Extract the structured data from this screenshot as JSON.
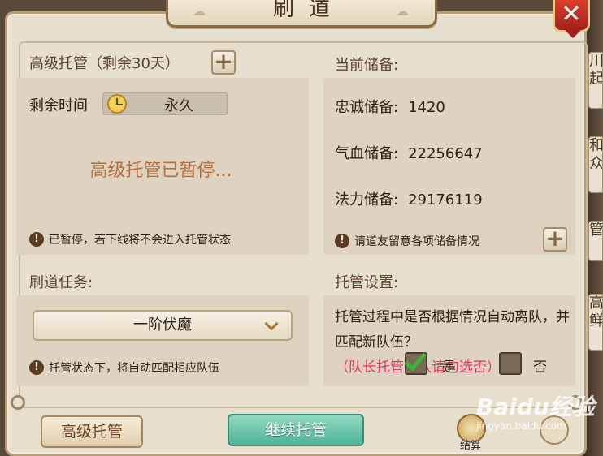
{
  "window": {
    "title": "刷道",
    "close_label": "✕"
  },
  "hosting": {
    "title": "高级托管（剩余30天）",
    "remaining_label": "剩余时间",
    "remaining_value": "永久",
    "status_text": "高级托管已暂停...",
    "note": "已暂停，若下线将不会进入托管状态"
  },
  "reserves": {
    "title": "当前储备:",
    "items": [
      {
        "label": "忠诚储备:",
        "value": "1420"
      },
      {
        "label": "气血储备:",
        "value": "22256647"
      },
      {
        "label": "法力储备:",
        "value": "29176119"
      }
    ],
    "note": "请道友留意各项储备情况"
  },
  "task": {
    "title": "刷道任务:",
    "selected": "一阶伏魔",
    "note": "托管状态下，将自动匹配相应队伍"
  },
  "settings": {
    "title": "托管设置:",
    "question": "托管过程中是否根据情况自动离队，并匹配新队伍？",
    "hint": "（队长托管带队请勾选否）",
    "yes_label": "是",
    "no_label": "否",
    "yes_checked": true,
    "no_checked": false
  },
  "buttons": {
    "advanced_hosting": "高级托管",
    "continue_hosting": "继续托管",
    "settle": "结算"
  },
  "side_tabs": [
    "川",
    "起",
    "和",
    "众",
    "管",
    "高",
    "鲜"
  ],
  "watermark": {
    "logo": "Baidu经验",
    "url": "jingyan.baidu.com"
  },
  "colors": {
    "accent_text": "#b86e3a",
    "hint_pink": "#e0336a",
    "continue_green": "#4fb497",
    "close_red": "#c0302a"
  }
}
